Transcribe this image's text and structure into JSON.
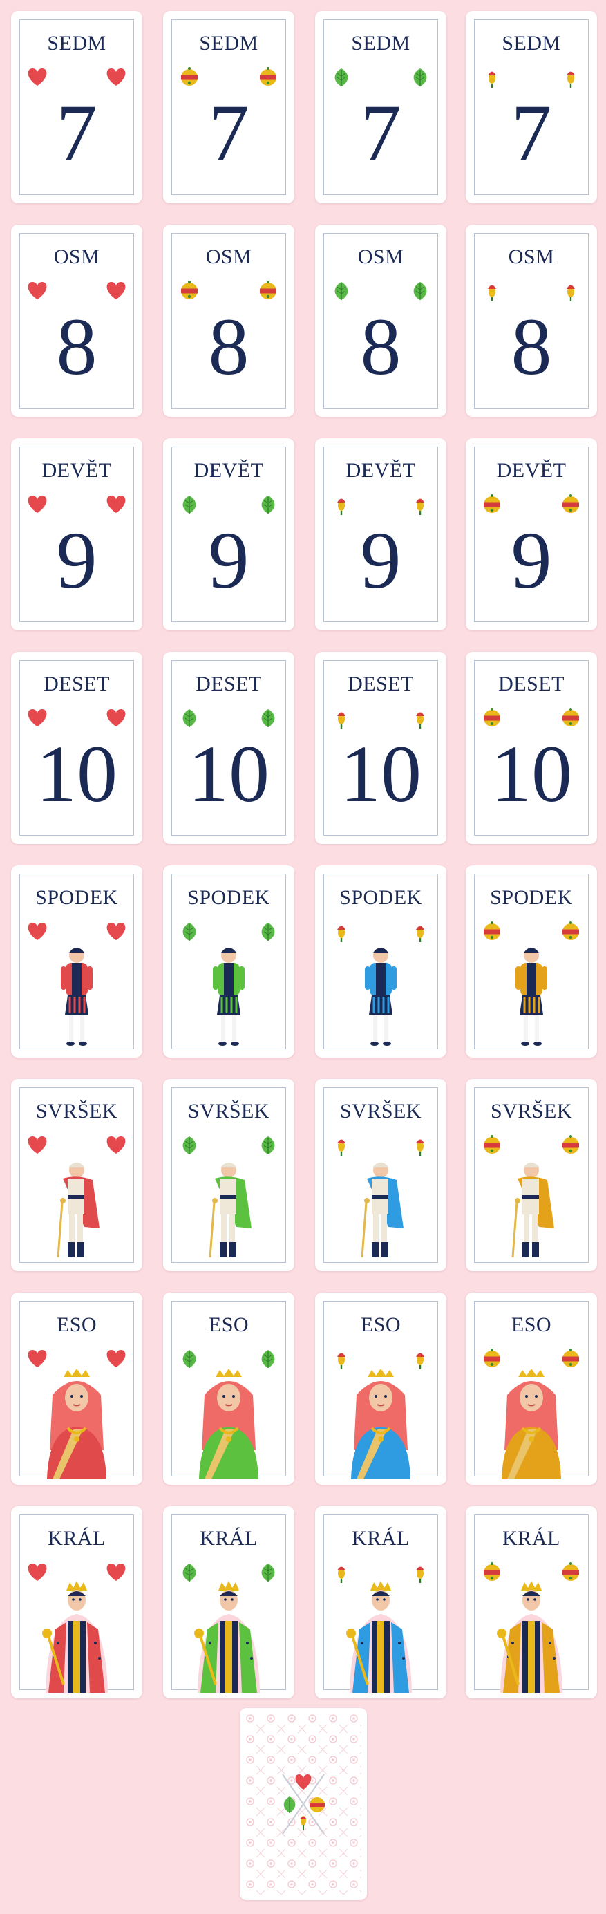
{
  "suits": [
    "hearts",
    "bells",
    "leaves",
    "acorns"
  ],
  "suit_icons": {
    "hearts": "heart-suit-icon",
    "bells": "bell-suit-icon",
    "leaves": "leaf-suit-icon",
    "acorns": "acorn-suit-icon"
  },
  "outfit_colors": {
    "hearts": "#e04a4a",
    "leaves": "#5cc13f",
    "acorns": "#2f9be0",
    "bells": "#e4a21a"
  },
  "rows": [
    {
      "label": "SEDM",
      "value": "7",
      "suits": [
        "hearts",
        "bells",
        "leaves",
        "acorns"
      ]
    },
    {
      "label": "OSM",
      "value": "8",
      "suits": [
        "hearts",
        "bells",
        "leaves",
        "acorns"
      ]
    },
    {
      "label": "DEVĚT",
      "value": "9",
      "suits": [
        "hearts",
        "leaves",
        "acorns",
        "bells"
      ]
    },
    {
      "label": "DESET",
      "value": "10",
      "suits": [
        "hearts",
        "leaves",
        "acorns",
        "bells"
      ]
    },
    {
      "label": "SPODEK",
      "figure": "under",
      "suits": [
        "hearts",
        "leaves",
        "acorns",
        "bells"
      ]
    },
    {
      "label": "SVRŠEK",
      "figure": "over",
      "suits": [
        "hearts",
        "leaves",
        "acorns",
        "bells"
      ]
    },
    {
      "label": "ESO",
      "figure": "queen",
      "suits": [
        "hearts",
        "leaves",
        "acorns",
        "bells"
      ]
    },
    {
      "label": "KRÁL",
      "figure": "king",
      "suits": [
        "hearts",
        "leaves",
        "acorns",
        "bells"
      ]
    }
  ],
  "card_back": {
    "icon": "card-back-icon"
  }
}
